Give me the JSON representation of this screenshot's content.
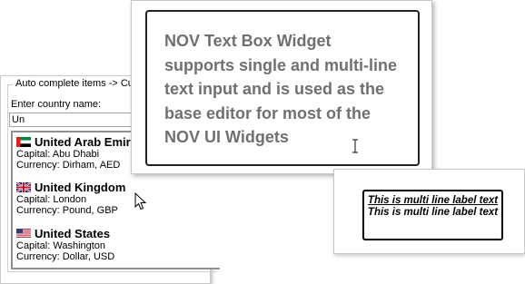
{
  "autocomplete": {
    "group_title": "Auto complete items -> Cus",
    "prompt": "Enter country name:",
    "input_value": "Un",
    "items": [
      {
        "name": "United Arab Emir",
        "capital": "Capital: Abu Dhabi",
        "currency": "Currency: Dirham, AED",
        "flag": "uae-flag-icon"
      },
      {
        "name": "United Kingdom",
        "capital": "Capital: London",
        "currency": "Currency: Pound, GBP",
        "flag": "uk-flag-icon"
      },
      {
        "name": "United States",
        "capital": "Capital: Washington",
        "currency": "Currency: Dollar, USD",
        "flag": "us-flag-icon"
      }
    ]
  },
  "textbox": {
    "text": "NOV Text Box Widget supports single and multi-line text input and is used as the base editor for most of the NOV UI Widgets"
  },
  "label": {
    "line1": "This is multi line label text",
    "line2": "This is multi line label text"
  },
  "colors": {
    "textbox_text": "#707070",
    "panel_border": "#c8c8c8"
  },
  "icons": {
    "text_cursor": "i-beam-cursor-icon",
    "mouse_pointer": "mouse-pointer-icon"
  }
}
